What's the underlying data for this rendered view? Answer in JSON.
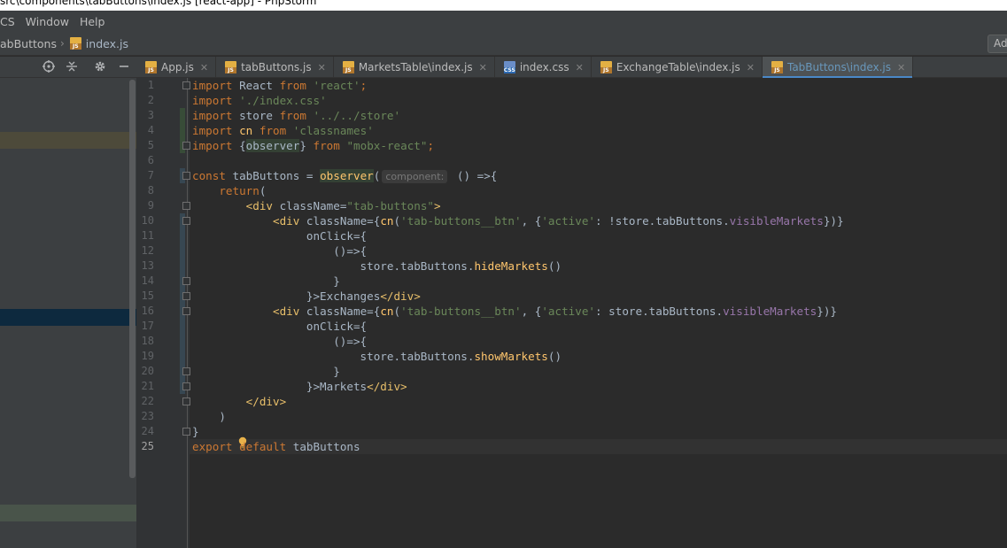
{
  "titlebar": {
    "text": "src\\components\\tabButtons\\index.js [react-app] - PhpStorm"
  },
  "menu": {
    "items": [
      "CS",
      "Window",
      "Help"
    ]
  },
  "navbar": {
    "folder": "abButtons",
    "file": "index.js",
    "add_config": "Ad"
  },
  "tabs": [
    {
      "label": "App.js",
      "icon": "js-file-icon"
    },
    {
      "label": "tabButtons.js",
      "icon": "js-file-icon"
    },
    {
      "label": "MarketsTable\\index.js",
      "icon": "js-file-icon"
    },
    {
      "label": "index.css",
      "icon": "css-file-icon"
    },
    {
      "label": "ExchangeTable\\index.js",
      "icon": "js-file-icon"
    },
    {
      "label": "TabButtons\\index.js",
      "icon": "js-file-icon",
      "active": true
    }
  ],
  "tab_close": "✕",
  "colors": {
    "keyword": "#cc7832",
    "string": "#6a8759",
    "tag": "#e8bf6a",
    "function": "#ffc66d",
    "property": "#9876aa",
    "active_tab": "#6897bb"
  },
  "editor": {
    "current_line": 25,
    "line_numbers": [
      "1",
      "2",
      "3",
      "4",
      "5",
      "6",
      "7",
      "8",
      "9",
      "10",
      "11",
      "12",
      "13",
      "14",
      "15",
      "16",
      "17",
      "18",
      "19",
      "20",
      "21",
      "22",
      "23",
      "24",
      "25"
    ],
    "param_hint": "component:",
    "code": {
      "l1": [
        "import",
        " React ",
        "from",
        " ",
        "'react'",
        ";"
      ],
      "l2": [
        "import",
        " ",
        "'./index.css'"
      ],
      "l3": [
        "import",
        " store ",
        "from",
        " ",
        "'../../store'"
      ],
      "l4": [
        "import",
        " ",
        "cn",
        " ",
        "from",
        " ",
        "'classnames'"
      ],
      "l5": [
        "import",
        " {",
        "observer",
        "} ",
        "from",
        " ",
        "\"mobx-react\"",
        ";"
      ],
      "l7": [
        "const",
        " tabButtons = ",
        "observer",
        "(",
        " () =>{"
      ],
      "l8": [
        "    ",
        "return",
        "("
      ],
      "l9": [
        "        ",
        "<div",
        " className=",
        "\"tab-buttons\"",
        ">"
      ],
      "l10": [
        "            ",
        "<div",
        " className={",
        "cn",
        "(",
        "'tab-buttons__btn'",
        ", {",
        "'active'",
        ": !store.tabButtons.",
        "visibleMarkets",
        "})}"
      ],
      "l11": [
        "                 onClick={"
      ],
      "l12": [
        "                     ()=>{"
      ],
      "l13": [
        "                         store.tabButtons.",
        "hideMarkets",
        "()"
      ],
      "l14": [
        "                     }"
      ],
      "l15": [
        "                 }>Exchanges",
        "</div>"
      ],
      "l16": [
        "            ",
        "<div",
        " className={",
        "cn",
        "(",
        "'tab-buttons__btn'",
        ", {",
        "'active'",
        ": store.tabButtons.",
        "visibleMarkets",
        "})}"
      ],
      "l17": [
        "                 onClick={"
      ],
      "l18": [
        "                     ()=>{"
      ],
      "l19": [
        "                         store.tabButtons.",
        "showMarkets",
        "()"
      ],
      "l20": [
        "                     }"
      ],
      "l21": [
        "                 }>Markets",
        "</div>"
      ],
      "l22": [
        "        ",
        "</div>"
      ],
      "l23": [
        "    )"
      ],
      "l24": [
        "}"
      ],
      "l25": [
        "export",
        " ",
        "default",
        " tabButtons"
      ]
    }
  }
}
